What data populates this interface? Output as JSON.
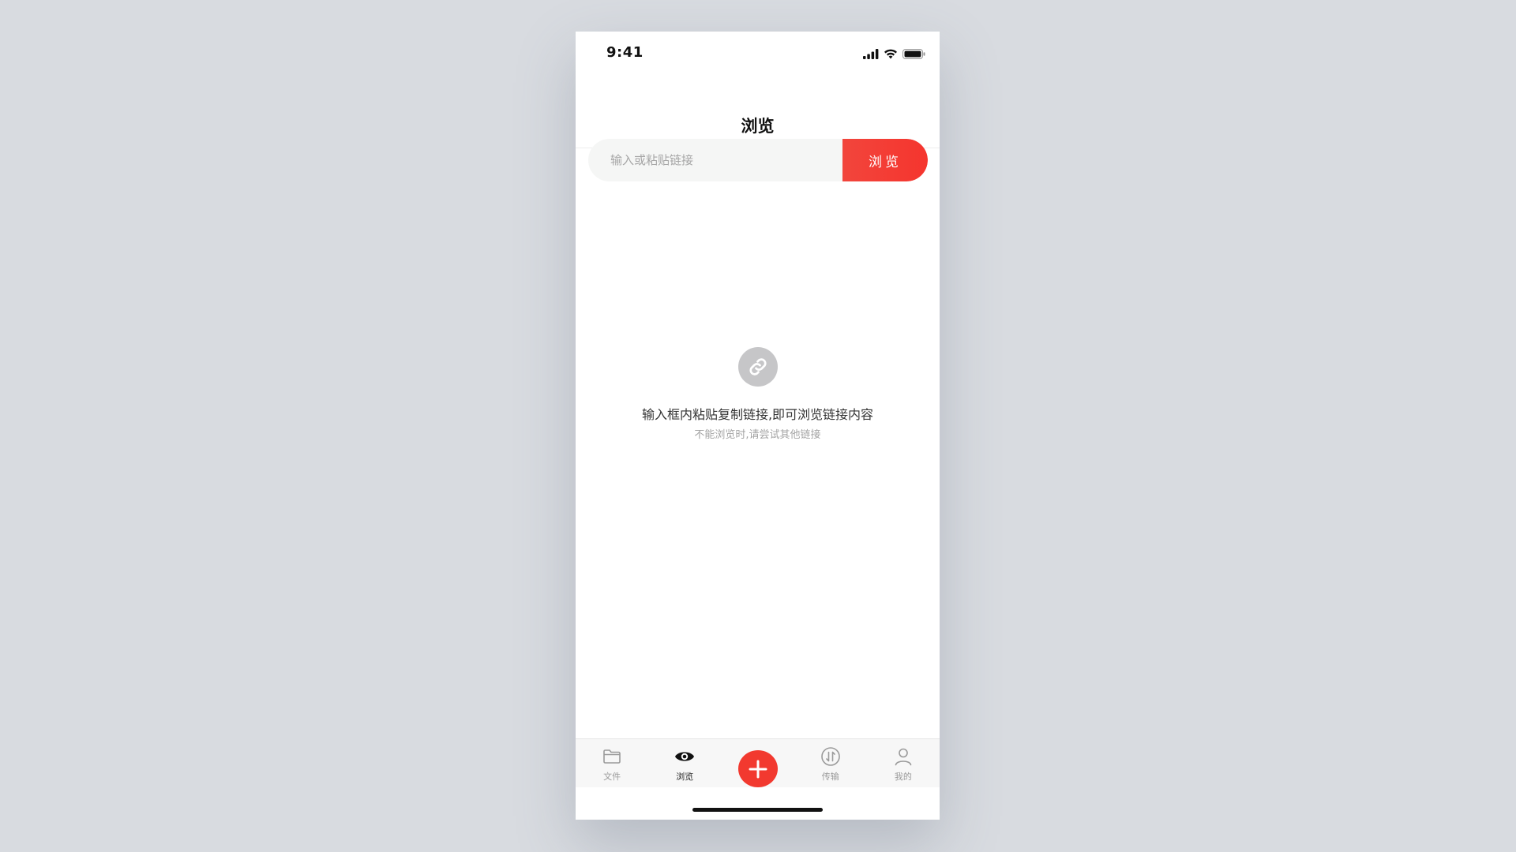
{
  "status_bar": {
    "time": "9:41",
    "icons": [
      "cellular-signal-icon",
      "wifi-icon",
      "battery-icon"
    ]
  },
  "nav": {
    "title": "浏览"
  },
  "search": {
    "placeholder": "输入或粘贴链接",
    "value": "",
    "button_label": "浏览"
  },
  "empty_state": {
    "icon": "link-icon",
    "title": "输入框内粘贴复制链接,即可浏览链接内容",
    "subtitle": "不能浏览时,请尝试其他链接"
  },
  "tab_bar": {
    "tabs": [
      {
        "label": "文件",
        "icon": "folder-icon",
        "active": false
      },
      {
        "label": "浏览",
        "icon": "eye-icon",
        "active": true
      },
      {
        "label": "",
        "icon": "plus-icon",
        "active": false
      },
      {
        "label": "传输",
        "icon": "transfer-icon",
        "active": false
      },
      {
        "label": "我的",
        "icon": "user-icon",
        "active": false
      }
    ]
  },
  "colors": {
    "accent": "#f2392f",
    "background": "#d8dbe0",
    "input_background": "#f5f6f5"
  }
}
